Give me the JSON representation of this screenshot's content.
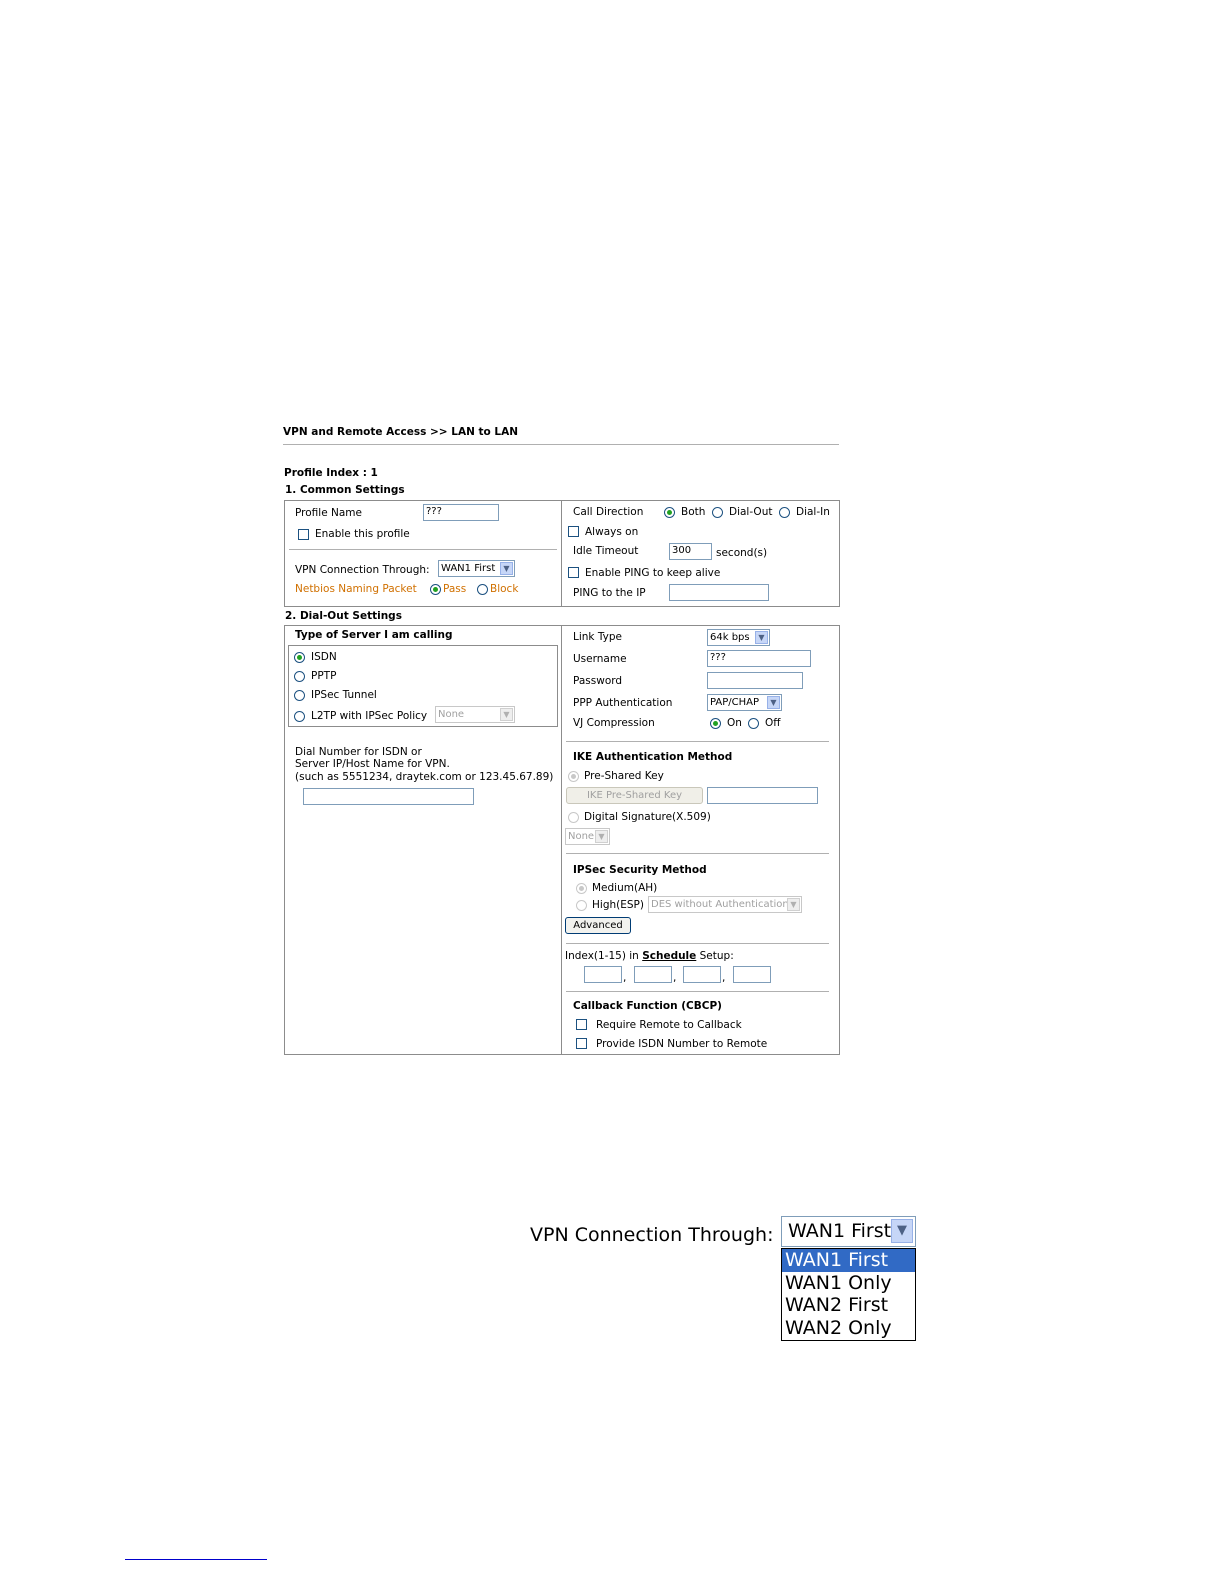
{
  "breadcrumb": "VPN and Remote Access >> LAN to LAN",
  "profile_index": "Profile Index : 1",
  "common": {
    "title": "1. Common Settings",
    "profile_name_label": "Profile Name",
    "profile_name_value": "???",
    "enable_profile_label": "Enable this profile",
    "vpn_through_label": "VPN Connection Through:",
    "vpn_through_value": "WAN1 First",
    "netbios_label": "Netbios Naming Packet",
    "netbios_pass": "Pass",
    "netbios_block": "Block",
    "call_direction_label": "Call Direction",
    "call_both": "Both",
    "call_dialout": "Dial-Out",
    "call_dialin": "Dial-In",
    "always_on_label": "Always on",
    "idle_timeout_label": "Idle Timeout",
    "idle_timeout_value": "300",
    "idle_timeout_unit": "second(s)",
    "enable_ping_label": "Enable PING to keep alive",
    "ping_ip_label": "PING to the IP"
  },
  "dialout": {
    "title": "2. Dial-Out Settings",
    "server_type_title": "Type of Server I am calling",
    "opt_isdn": "ISDN",
    "opt_pptp": "PPTP",
    "opt_ipsec": "IPSec Tunnel",
    "opt_l2tp": "L2TP with IPSec Policy",
    "l2tp_policy_value": "None",
    "dial_number_line1": "Dial Number for ISDN or",
    "dial_number_line2": "Server IP/Host Name for VPN.",
    "dial_number_line3": "(such as 5551234, draytek.com or 123.45.67.89)",
    "link_type_label": "Link Type",
    "link_type_value": "64k bps",
    "username_label": "Username",
    "username_value": "???",
    "password_label": "Password",
    "ppp_auth_label": "PPP Authentication",
    "ppp_auth_value": "PAP/CHAP",
    "vj_label": "VJ Compression",
    "vj_on": "On",
    "vj_off": "Off",
    "ike_title": "IKE Authentication Method",
    "ike_psk": "Pre-Shared Key",
    "ike_psk_button": "IKE Pre-Shared Key",
    "ike_digital": "Digital Signature(X.509)",
    "ike_digital_value": "None",
    "ipsec_title": "IPSec Security Method",
    "ipsec_medium": "Medium(AH)",
    "ipsec_high": "High(ESP)",
    "ipsec_high_value": "DES without Authentication",
    "advanced_button": "Advanced",
    "schedule_prefix": "Index(1-15) in",
    "schedule_link": "Schedule",
    "schedule_suffix": "Setup:",
    "callback_title": "Callback Function (CBCP)",
    "callback_require": "Require Remote to Callback",
    "callback_provide": "Provide ISDN Number to Remote"
  },
  "zoom": {
    "label": "VPN Connection Through:",
    "selected": "WAN1 First",
    "options": [
      "WAN1 First",
      "WAN1 Only",
      "WAN2 First",
      "WAN2 Only"
    ]
  }
}
